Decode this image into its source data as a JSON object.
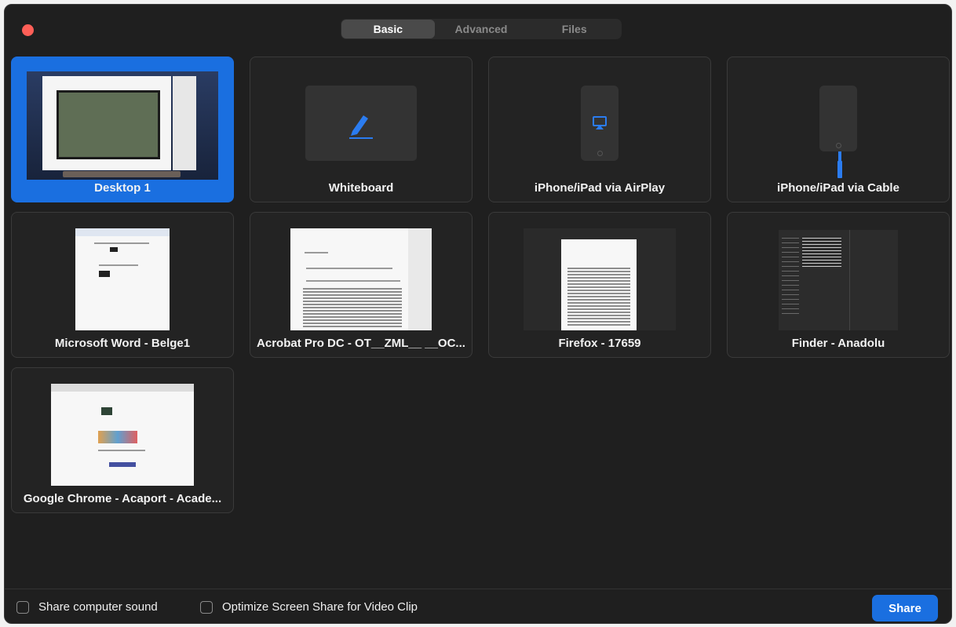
{
  "tabs": [
    "Basic",
    "Advanced",
    "Files"
  ],
  "active_tab": "Basic",
  "cards": [
    {
      "label": "Desktop 1",
      "selected": true,
      "kind": "desktop"
    },
    {
      "label": "Whiteboard",
      "kind": "whiteboard"
    },
    {
      "label": "iPhone/iPad via AirPlay",
      "kind": "airplay"
    },
    {
      "label": "iPhone/iPad via Cable",
      "kind": "cable"
    },
    {
      "label": "Microsoft Word - Belge1",
      "kind": "word"
    },
    {
      "label": "Acrobat Pro DC - OT__ZML__ __OC...",
      "kind": "acrobat"
    },
    {
      "label": "Firefox - 17659",
      "kind": "firefox"
    },
    {
      "label": "Finder - Anadolu",
      "kind": "finder"
    },
    {
      "label": "Google Chrome - Acaport - Acade...",
      "kind": "chrome"
    }
  ],
  "options": {
    "share_sound": "Share computer sound",
    "optimize_video": "Optimize Screen Share for Video Clip"
  },
  "share_button": "Share",
  "colors": {
    "accent": "#1a6fe0",
    "background": "#1f1f1f",
    "close": "#ff5f57"
  }
}
